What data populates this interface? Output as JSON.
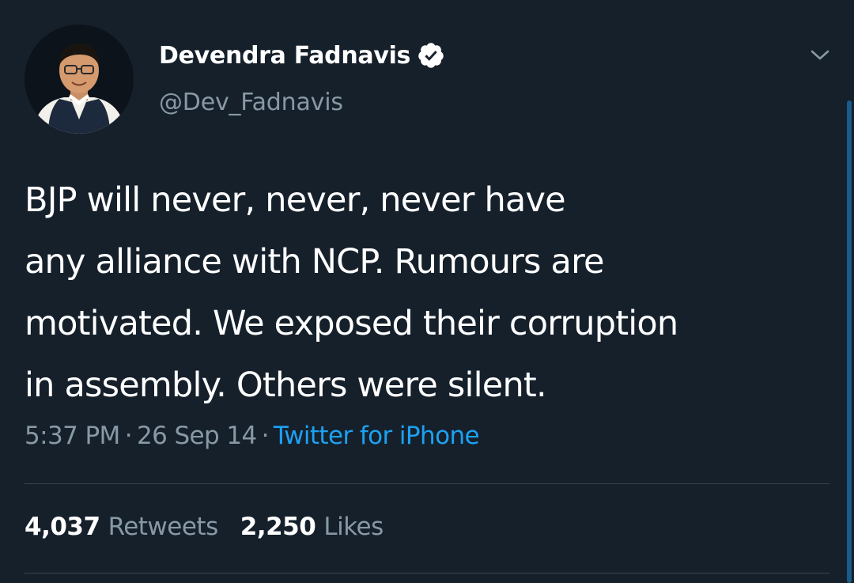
{
  "tweet": {
    "author": {
      "display_name": "Devendra Fadnavis",
      "handle": "@Dev_Fadnavis",
      "verified": true,
      "avatar_icon": "profile-photo"
    },
    "text_lines": [
      "BJP will never, never, never have",
      "any alliance with NCP. Rumours are",
      "motivated. We exposed their corruption",
      "in assembly. Others were silent."
    ],
    "meta": {
      "time": "5:37 PM",
      "date": "26 Sep 14",
      "separator": "·",
      "source": "Twitter for iPhone"
    },
    "stats": {
      "retweets_count": "4,037",
      "retweets_label": "Retweets",
      "likes_count": "2,250",
      "likes_label": "Likes"
    }
  },
  "colors": {
    "background": "#15202b",
    "text_primary": "#ffffff",
    "text_secondary": "#8899a6",
    "accent": "#1da1f2",
    "divider": "#38444d"
  },
  "icons": {
    "verified": "verified-badge-icon",
    "menu": "chevron-down-icon"
  }
}
